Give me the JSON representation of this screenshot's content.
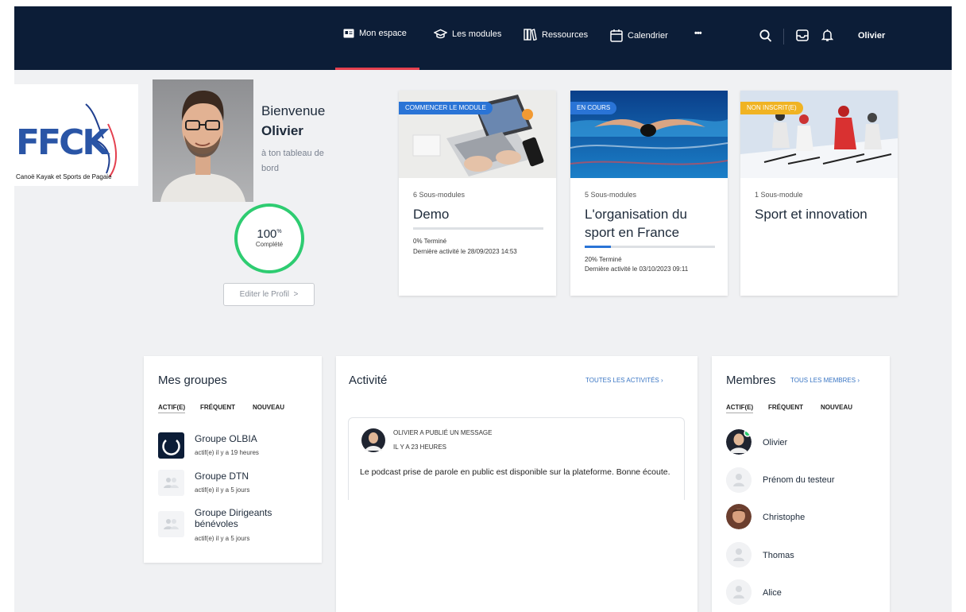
{
  "nav": {
    "items": [
      {
        "label": "Mon espace",
        "icon": "id-card-icon"
      },
      {
        "label": "Les modules",
        "icon": "graduation-cap-icon"
      },
      {
        "label": "Ressources",
        "icon": "books-icon"
      },
      {
        "label": "Calendrier",
        "icon": "calendar-icon"
      },
      {
        "label": "•••",
        "icon": "more-icon"
      }
    ],
    "user": "Olivier"
  },
  "logo": {
    "letters": "FFCK",
    "tagline": "Canoë Kayak et Sports de Pagaie"
  },
  "profile": {
    "greeting": "Bienvenue",
    "name": "Olivier",
    "subtitle": "à ton tableau de bord",
    "progress_value": "100",
    "progress_unit": "%",
    "progress_label": "Complété",
    "progress_fraction": 1.0,
    "edit_label": "Editer le Profil",
    "edit_chevron": ">"
  },
  "modules": [
    {
      "badge": "COMMENCER LE MODULE",
      "badge_color": "#2a74d6",
      "sub": "6 Sous-modules",
      "title": "Demo",
      "progress": 0.0,
      "progress_text": "0% Terminé",
      "last_activity": "Dernière activité le 28/09/2023 14:53"
    },
    {
      "badge": "EN COURS",
      "badge_color": "#2a74d6",
      "sub": "5 Sous-modules",
      "title": "L'organisation du sport en France",
      "progress": 0.2,
      "progress_text": "20% Terminé",
      "last_activity": "Dernière activité le 03/10/2023 09:11"
    },
    {
      "badge": "NON INSCRIT(E)",
      "badge_color": "#f0b323",
      "sub": "1 Sous-module",
      "title": "Sport et innovation"
    }
  ],
  "groups_panel": {
    "title": "Mes groupes",
    "filters": [
      "ACTIF(E)",
      "FRÉQUENT",
      "NOUVEAU"
    ],
    "items": [
      {
        "name": "Groupe OLBIA",
        "meta": "actif(e) il y a 19 heures"
      },
      {
        "name": "Groupe DTN",
        "meta": "actif(e) il y a 5 jours"
      },
      {
        "name": "Groupe Dirigeants bénévoles",
        "meta": "actif(e) il y a 5 jours"
      }
    ]
  },
  "activity_panel": {
    "title": "Activité",
    "all_link": "TOUTES LES ACTIVITÉS ›",
    "post": {
      "author_line": "OLIVIER A PUBLIÉ UN MESSAGE",
      "time": "IL Y A 23 HEURES",
      "text": "Le podcast prise de parole en public est disponible sur la plateforme. Bonne écoute."
    }
  },
  "members_panel": {
    "title": "Membres",
    "all_link": "TOUS LES MEMBRES ›",
    "filters": [
      "ACTIF(E)",
      "FRÉQUENT",
      "NOUVEAU"
    ],
    "items": [
      "Olivier",
      "Prénom du testeur",
      "Christophe",
      "Thomas",
      "Alice"
    ]
  },
  "colors": {
    "topbar": "#0c1d37",
    "accent": "#e4404f",
    "success": "#2ecc71",
    "link": "#3a76c4"
  }
}
